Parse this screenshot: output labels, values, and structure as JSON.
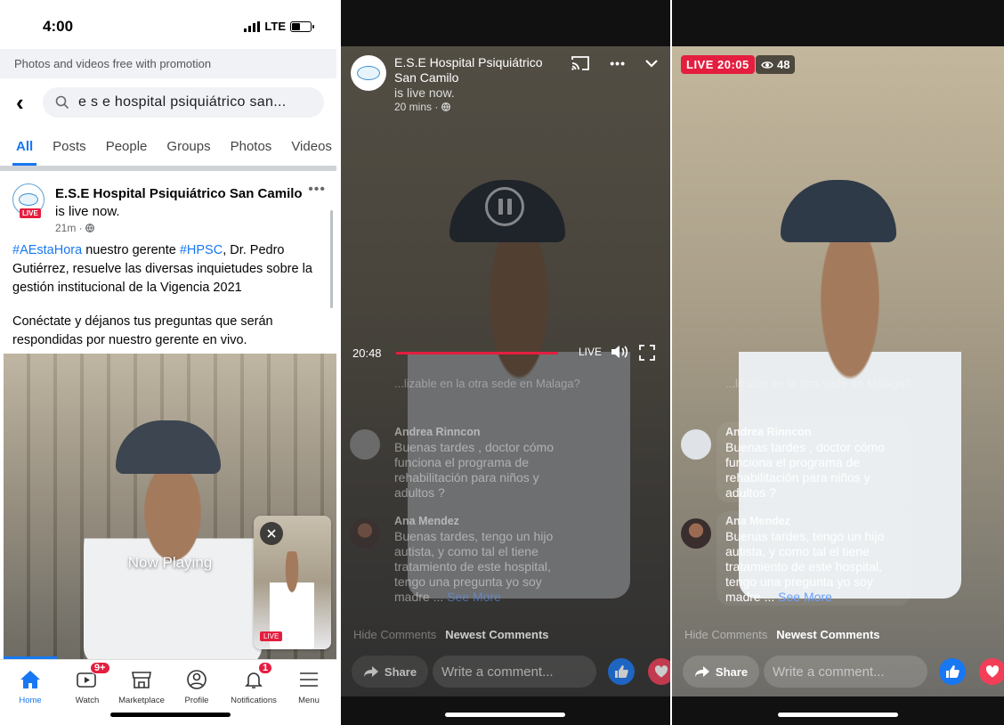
{
  "left_screen": {
    "status_bar": {
      "time": "4:00",
      "network": "LTE"
    },
    "promo_banner": "Photos and videos free with promotion",
    "search": {
      "value": "e s e hospital psiquiátrico san..."
    },
    "tabs": [
      {
        "label": "All",
        "active": true
      },
      {
        "label": "Posts"
      },
      {
        "label": "People"
      },
      {
        "label": "Groups"
      },
      {
        "label": "Photos"
      },
      {
        "label": "Videos"
      }
    ],
    "post": {
      "author": "E.S.E Hospital Psiquiátrico San Camilo",
      "status_text": " is live now.",
      "live_badge": "LIVE",
      "time": "21m · ",
      "text_tag1": "#AEstaHora",
      "text_mid1": " nuestro gerente ",
      "text_tag2": "#HPSC",
      "text_rest": ", Dr. Pedro Gutiérrez, resuelve las diversas inquietudes sobre la gestión institucional de la Vigencia 2021",
      "text_second": "Conéctate y déjanos tus preguntas que serán respondidas por nuestro gerente en vivo."
    },
    "video": {
      "now_playing": "Now Playing",
      "mini_live": "LIVE"
    },
    "bottom_nav": [
      {
        "label": "Home",
        "icon": "home-icon",
        "active": true
      },
      {
        "label": "Watch",
        "icon": "watch-icon",
        "badge": "9+"
      },
      {
        "label": "Marketplace",
        "icon": "marketplace-icon"
      },
      {
        "label": "Profile",
        "icon": "profile-icon"
      },
      {
        "label": "Notifications",
        "icon": "bell-icon",
        "badge": "1"
      },
      {
        "label": "Menu",
        "icon": "menu-icon"
      }
    ]
  },
  "middle_screen": {
    "page_name": "E.S.E Hospital Psiquiátrico San Camilo",
    "live_status": "is live now.",
    "meta": "20 mins · ",
    "elapsed": "20:48",
    "live_label": "LIVE"
  },
  "right_screen": {
    "live_badge": "LIVE 20:05",
    "viewers": "48"
  },
  "comments": {
    "faded_partial": "...lizable en la otra sede en Malaga?",
    "items": [
      {
        "name": "Andrea Rinncon",
        "text": "Buenas tardes , doctor cómo funciona el programa de rehabilitación para niños y adultos ?"
      },
      {
        "name": "Ana Mendez",
        "text": "Buenas tardes, tengo un hijo autista, y como tal el tiene tratamiento de este hospital, tengo una pregunta yo soy madre ... ",
        "see_more": "See More"
      }
    ],
    "hide_comments": "Hide Comments",
    "newest_comments": "Newest Comments",
    "share_label": "Share",
    "comment_placeholder": "Write a comment..."
  },
  "colors": {
    "brand_blue": "#1877f2",
    "live_red": "#e41e3f",
    "love_red": "#f33e58"
  }
}
